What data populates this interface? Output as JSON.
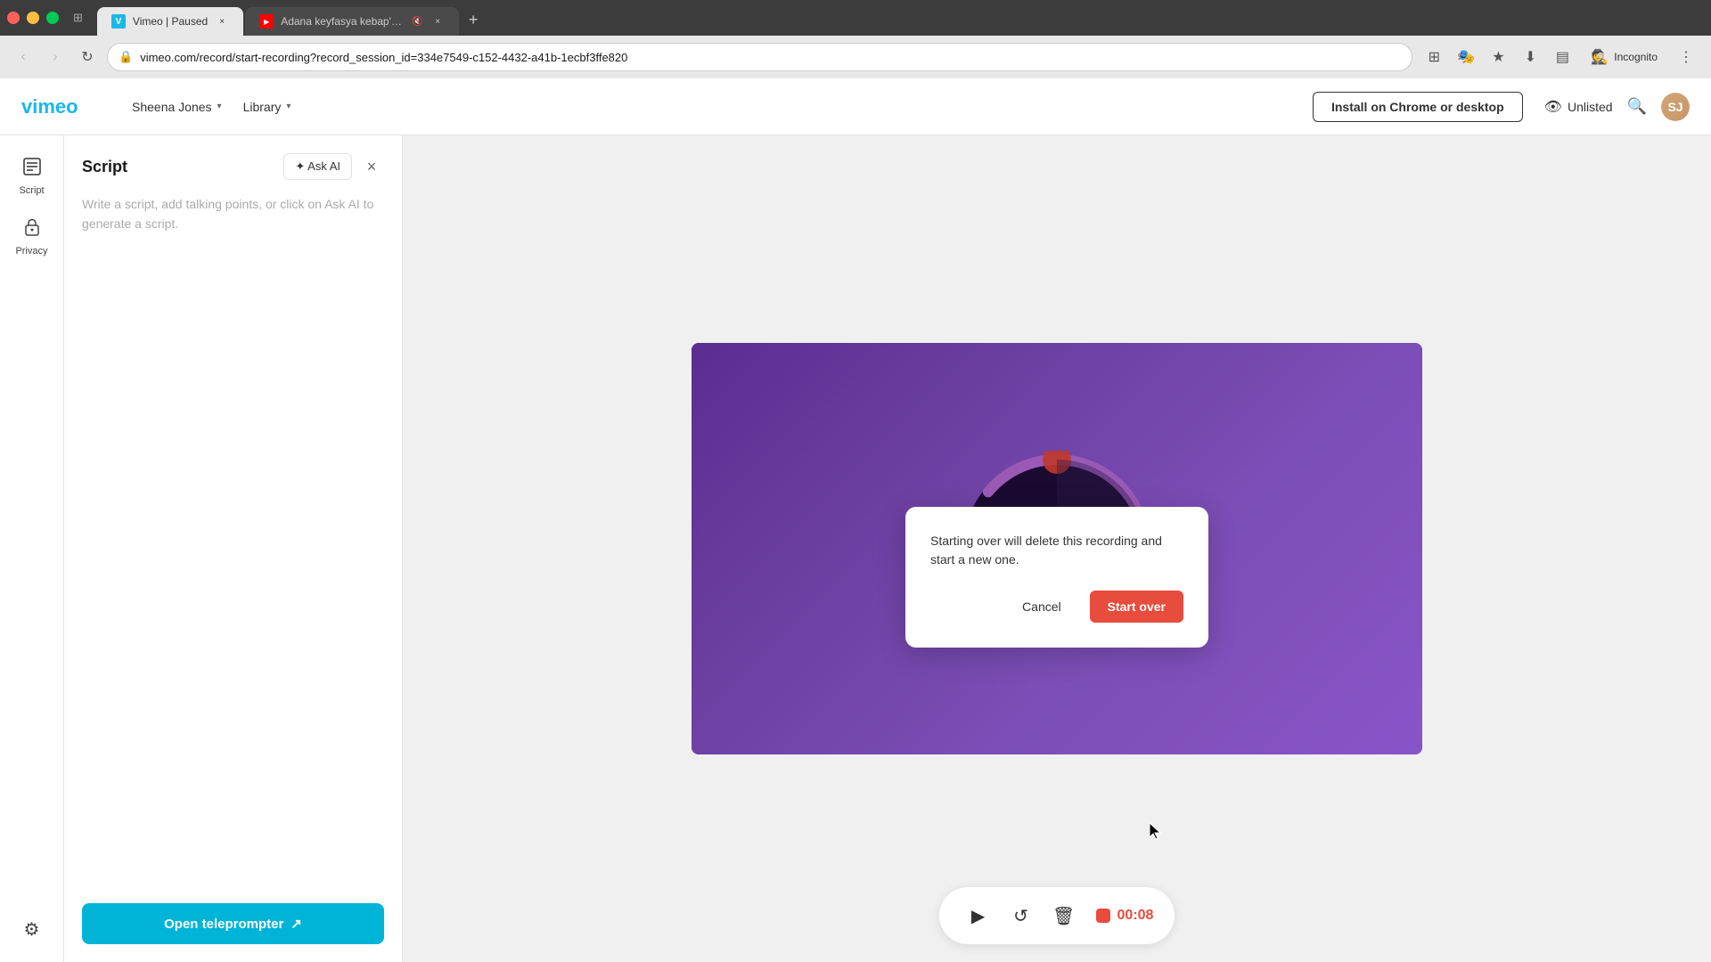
{
  "browser": {
    "tabs": [
      {
        "id": "tab-vimeo",
        "title": "Vimeo | Paused",
        "favicon_color": "#1ab7ea",
        "favicon_char": "V",
        "active": true,
        "muted": false
      },
      {
        "id": "tab-adana",
        "title": "Adana keyfasya kebap'dan",
        "favicon_color": "#ff0000",
        "favicon_char": "▶",
        "active": false,
        "muted": true
      }
    ],
    "new_tab_label": "+",
    "nav": {
      "back_label": "‹",
      "forward_label": "›",
      "reload_label": "↻",
      "url": "vimeo.com/record/start-recording?record_session_id=334e7549-c152-4432-a41b-1ecbf3ffe820"
    },
    "toolbar_icons": [
      "⊞",
      "🔒",
      "★",
      "⬇",
      "▤"
    ],
    "incognito_label": "Incognito",
    "menu_icon": "⋮"
  },
  "header": {
    "logo_text": "vimeo",
    "nav_items": [
      {
        "label": "Sheena Jones",
        "has_dropdown": true
      },
      {
        "label": "Library",
        "has_dropdown": true
      }
    ],
    "install_btn_label": "Install on Chrome or desktop",
    "unlisted_label": "Unlisted",
    "search_placeholder": "Search"
  },
  "sidebar": {
    "items": [
      {
        "id": "script",
        "label": "Script",
        "icon": "📄",
        "active": true
      },
      {
        "id": "privacy",
        "label": "Privacy",
        "icon": "🔒",
        "active": false
      }
    ]
  },
  "script_panel": {
    "title": "Script",
    "ask_ai_label": "✦ Ask AI",
    "close_label": "×",
    "placeholder": "Write a script, add talking points, or click on Ask AI to generate a script.",
    "teleprompter_label": "Open teleprompter",
    "teleprompter_icon": "↗"
  },
  "video": {
    "bg_color_start": "#5c2d91",
    "bg_color_end": "#8855c8"
  },
  "dialog": {
    "message": "Starting over will delete this recording and start a new one.",
    "cancel_label": "Cancel",
    "start_over_label": "Start over"
  },
  "controls": {
    "play_icon": "▶",
    "replay_icon": "↺",
    "delete_icon": "🗑",
    "rec_time": "00:08"
  }
}
